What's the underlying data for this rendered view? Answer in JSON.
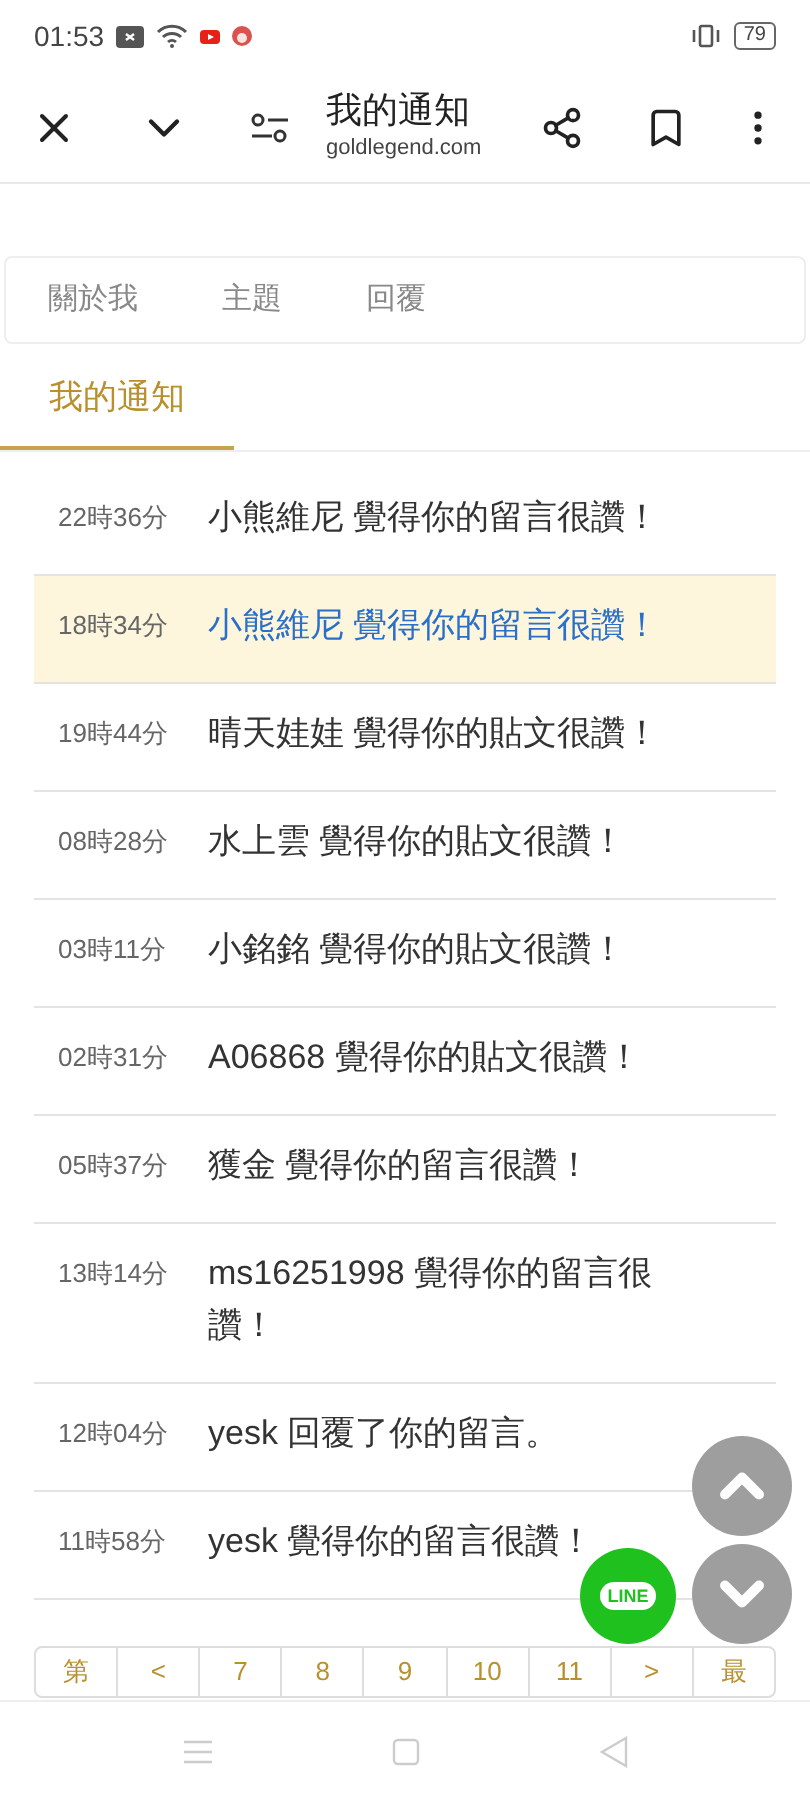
{
  "status_bar": {
    "time": "01:53",
    "battery": "79"
  },
  "toolbar": {
    "title": "我的通知",
    "subtitle": "goldlegend.com"
  },
  "tabs": [
    {
      "label": "關於我",
      "selected": false
    },
    {
      "label": "主題",
      "selected": false
    },
    {
      "label": "回覆",
      "selected": false
    }
  ],
  "section_tab": {
    "label": "我的通知",
    "selected": true
  },
  "notifications": [
    {
      "time": "22時36分",
      "text": "小熊維尼 覺得你的留言很讚！",
      "selected": false
    },
    {
      "time": "18時34分",
      "text": "小熊維尼 覺得你的留言很讚！",
      "selected": true
    },
    {
      "time": "19時44分",
      "text": "晴天娃娃 覺得你的貼文很讚！",
      "selected": false
    },
    {
      "time": "08時28分",
      "text": "水上雲 覺得你的貼文很讚！",
      "selected": false
    },
    {
      "time": "03時11分",
      "text": "小銘銘 覺得你的貼文很讚！",
      "selected": false
    },
    {
      "time": "02時31分",
      "text": "A06868 覺得你的貼文很讚！",
      "selected": false
    },
    {
      "time": "05時37分",
      "text": "獲金 覺得你的留言很讚！",
      "selected": false
    },
    {
      "time": "13時14分",
      "text": "ms16251998 覺得你的留言很讚！",
      "selected": false
    },
    {
      "time": "12時04分",
      "text": "yesk 回覆了你的留言。",
      "selected": false
    },
    {
      "time": "11時58分",
      "text": "yesk 覺得你的留言很讚！",
      "selected": false
    }
  ],
  "pagination": [
    "第",
    "<",
    "7",
    "8",
    "9",
    "10",
    "11",
    ">",
    "最"
  ],
  "line_button": {
    "label": "LINE"
  }
}
